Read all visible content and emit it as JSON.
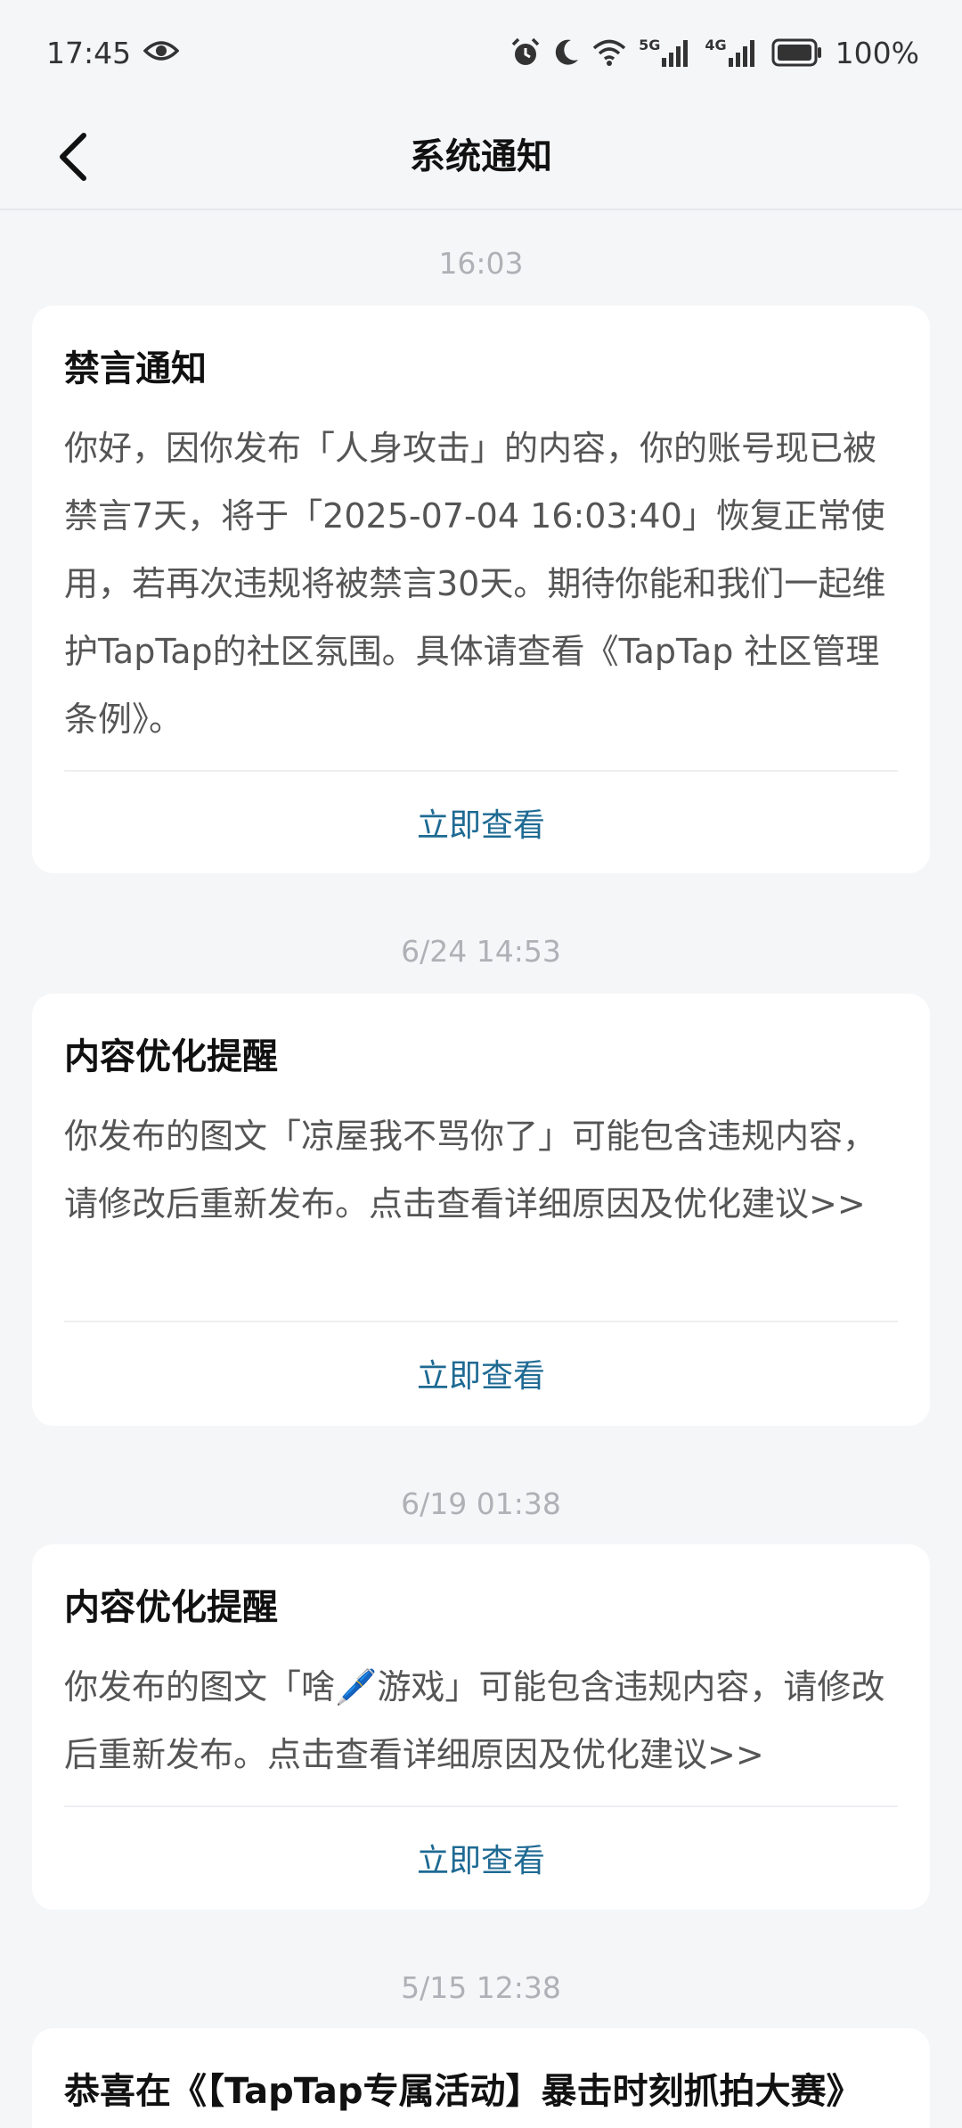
{
  "status_bar": {
    "time": "17:45",
    "battery": "100%",
    "network_5g": "5G",
    "network_4g": "4G",
    "icons": [
      "eye-icon",
      "alarm-icon",
      "moon-icon",
      "wifi-icon",
      "signal-icon",
      "battery-icon"
    ]
  },
  "header": {
    "title": "系统通知",
    "back_icon": "chevron-left-icon"
  },
  "notifications": [
    {
      "time": "16:03",
      "title": "禁言通知",
      "body": "你好，因你发布「人身攻击」的内容，你的账号现已被禁言7天，将于「2025-07-04 16:03:40」恢复正常使用，若再次违规将被禁言30天。期待你能和我们一起维护TapTap的社区氛围。具体请查看《TapTap 社区管理条例》。",
      "action": "立即查看"
    },
    {
      "time": "6/24  14:53",
      "title": "内容优化提醒",
      "body": "你发布的图文「凉屋我不骂你了」可能包含违规内容，请修改后重新发布。点击查看详细原因及优化建议>>",
      "action": "立即查看"
    },
    {
      "time": "6/19  01:38",
      "title": "内容优化提醒",
      "body": "你发布的图文「啥🖊️游戏」可能包含违规内容，请修改后重新发布。点击查看详细原因及优化建议>>",
      "action": "立即查看"
    },
    {
      "time": "5/15  12:38",
      "title": "恭喜在《【TapTap专属活动】暴击时刻抓拍大赛》"
    }
  ],
  "colors": {
    "background": "#f5f6f8",
    "card": "#ffffff",
    "action_link": "#1e6a93",
    "timestamp": "#aeb1b6",
    "body_text": "#555555"
  }
}
